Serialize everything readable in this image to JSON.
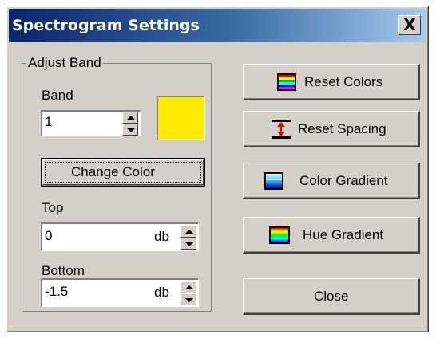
{
  "window": {
    "title": "Spectrogram Settings",
    "close_glyph": "X"
  },
  "adjust_band": {
    "group_label": "Adjust Band",
    "band_label": "Band",
    "band_value": "1",
    "swatch_color": "#ffea00",
    "change_color_label": "Change Color",
    "top_label": "Top",
    "top_value": "0",
    "top_unit": "db",
    "bottom_label": "Bottom",
    "bottom_value": "-1.5",
    "bottom_unit": "db"
  },
  "buttons": {
    "reset_colors": {
      "label": "Reset Colors",
      "icon": "color-bands-icon"
    },
    "reset_spacing": {
      "label": "Reset Spacing",
      "icon": "spacing-arrow-icon"
    },
    "color_gradient": {
      "label": "Color Gradient",
      "icon": "blue-gradient-icon"
    },
    "hue_gradient": {
      "label": "Hue Gradient",
      "icon": "hue-gradient-icon"
    },
    "close": {
      "label": "Close"
    }
  }
}
